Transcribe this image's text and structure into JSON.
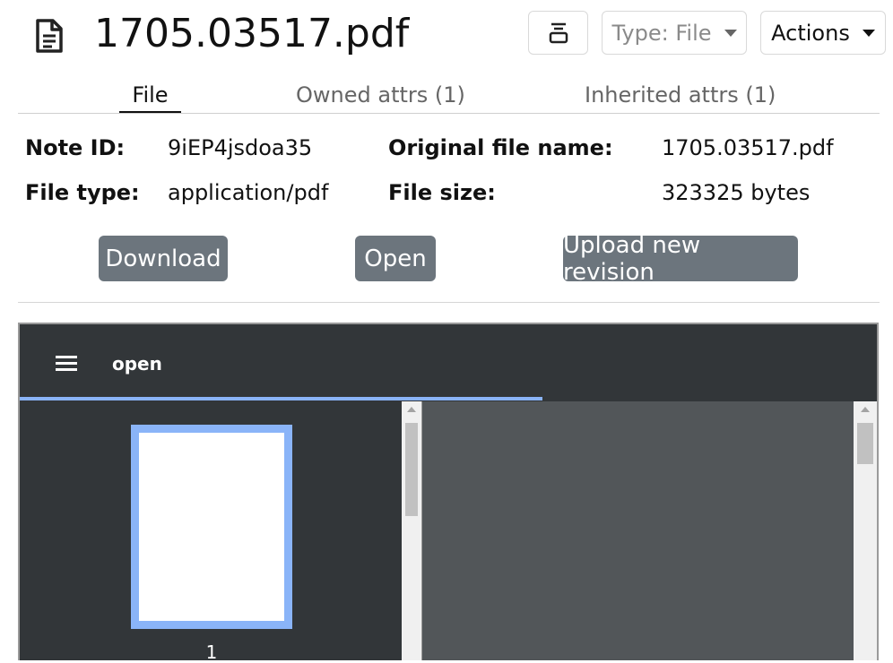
{
  "header": {
    "title": "1705.03517.pdf",
    "type_label": "Type: File",
    "actions_label": "Actions",
    "icon": "file-text-icon"
  },
  "tabs": [
    {
      "label": "File",
      "active": true
    },
    {
      "label": "Owned attrs (1)",
      "active": false
    },
    {
      "label": "Inherited attrs (1)",
      "active": false
    }
  ],
  "info": {
    "note_id_label": "Note ID:",
    "note_id": "9iEP4jsdoa35",
    "file_type_label": "File type:",
    "file_type": "application/pdf",
    "orig_name_label": "Original file name:",
    "orig_name": "1705.03517.pdf",
    "file_size_label": "File size:",
    "file_size": "323325 bytes"
  },
  "buttons": {
    "download": "Download",
    "open": "Open",
    "upload": "Upload new revision"
  },
  "viewer": {
    "doc_title": "open",
    "page_number": "1",
    "load_progress_fraction": 0.61
  },
  "colors": {
    "accent": "#8ab4f8",
    "viewer_toolbar": "#323639",
    "viewer_canvas": "#525659",
    "button_secondary": "#6c757d"
  }
}
